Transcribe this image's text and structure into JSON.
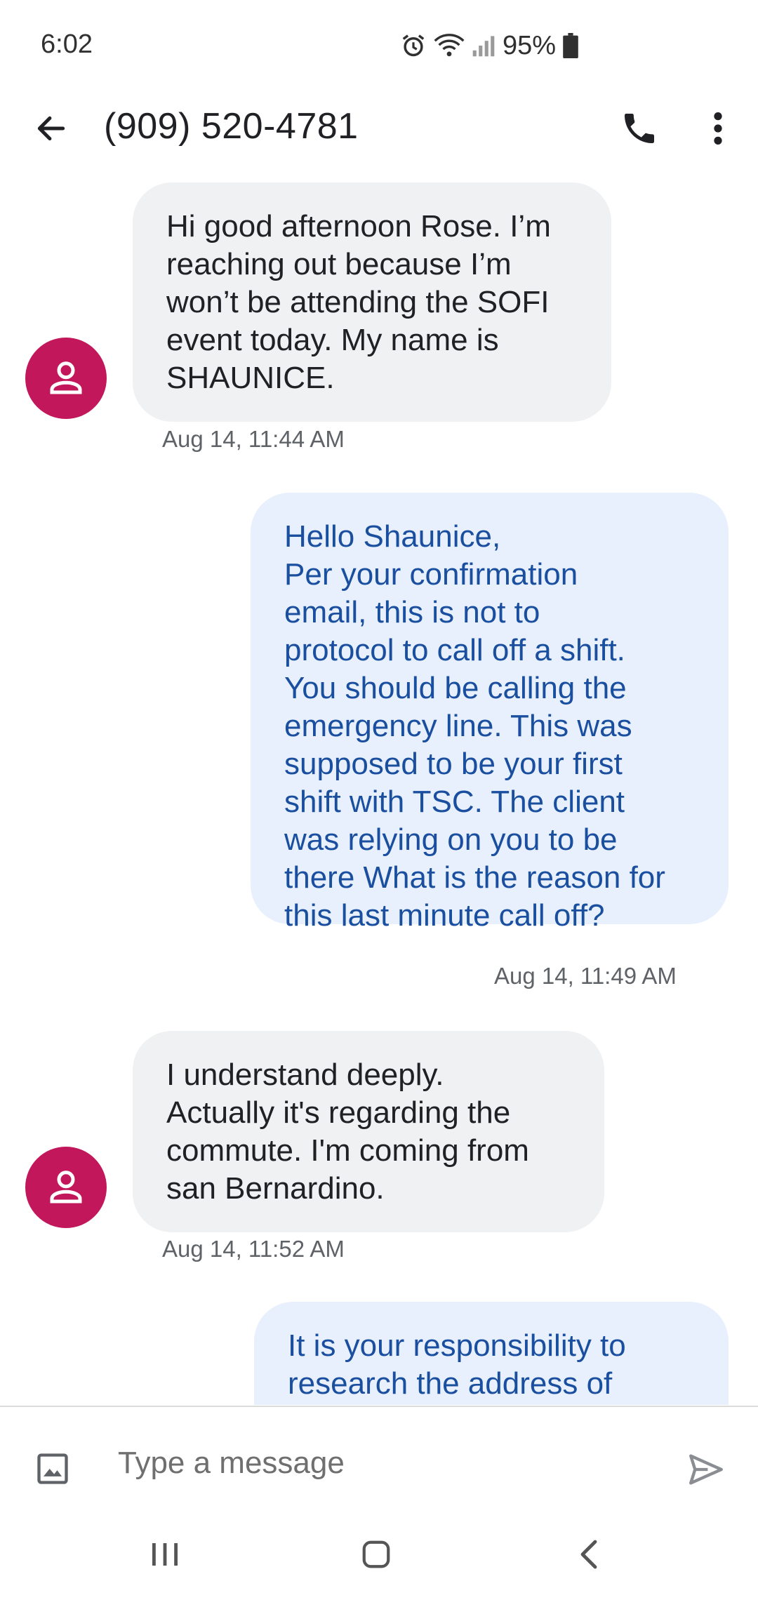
{
  "status_bar": {
    "time": "6:02",
    "battery": "95%",
    "icons": [
      "alarm-icon",
      "wifi-icon",
      "signal-icon",
      "battery-icon"
    ]
  },
  "app_bar": {
    "title": "(909) 520-4781",
    "icons": [
      "back-arrow-icon",
      "phone-icon",
      "more-vert-icon"
    ]
  },
  "messages": [
    {
      "direction": "incoming",
      "text": "Hi good afternoon Rose. I’m\nreaching out because I’m\nwon’t be attending the SOFI\nevent today. My name is\nSHAUNICE.",
      "timestamp": "Aug 14, 11:44 AM"
    },
    {
      "direction": "outgoing",
      "text": "Hello Shaunice,\nPer your confirmation\nemail, this is not to\nprotocol to call off a shift.\nYou should be calling the\nemergency line. This was\nsupposed to be your first\nshift with TSC. The client\nwas relying on you to be\nthere What is the reason for\nthis last minute call off?",
      "timestamp": "Aug 14, 11:49 AM"
    },
    {
      "direction": "incoming",
      "text": "I understand deeply.\nActually it's regarding the\ncommute. I'm coming from\nsan Bernardino.",
      "timestamp": "Aug 14, 11:52 AM"
    },
    {
      "direction": "outgoing",
      "text": "It is your responsibility to\nresearch the address of",
      "timestamp": ""
    }
  ],
  "composer": {
    "placeholder": "Type a message",
    "icons": [
      "image-attach-icon",
      "send-icon"
    ]
  },
  "nav_bar": {
    "icons": [
      "recents-icon",
      "home-icon",
      "back-icon"
    ]
  },
  "colors": {
    "avatar": "#c2185b",
    "incoming_bubble": "#f0f1f3",
    "outgoing_bubble": "#e8f0fd",
    "outgoing_text": "#1a4fa0"
  }
}
